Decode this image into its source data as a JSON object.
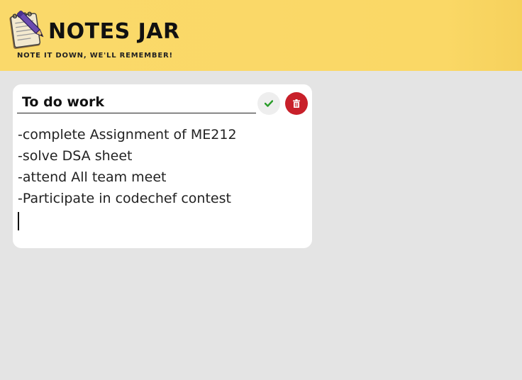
{
  "header": {
    "logo_icon": "notepad-pen-icon",
    "title": "NOTES JAR",
    "tagline": "NOTE IT DOWN, WE'LL REMEMBER!",
    "background": "#fad96a"
  },
  "note": {
    "title": "To do work",
    "lines": [
      "-complete Assignment of ME212",
      "-solve DSA sheet",
      "-attend All team meet",
      "-Participate in codechef contest"
    ],
    "save_icon": "check-icon",
    "delete_icon": "trash-icon",
    "save_color": "#2a9d2a",
    "delete_color": "#c8202a"
  }
}
